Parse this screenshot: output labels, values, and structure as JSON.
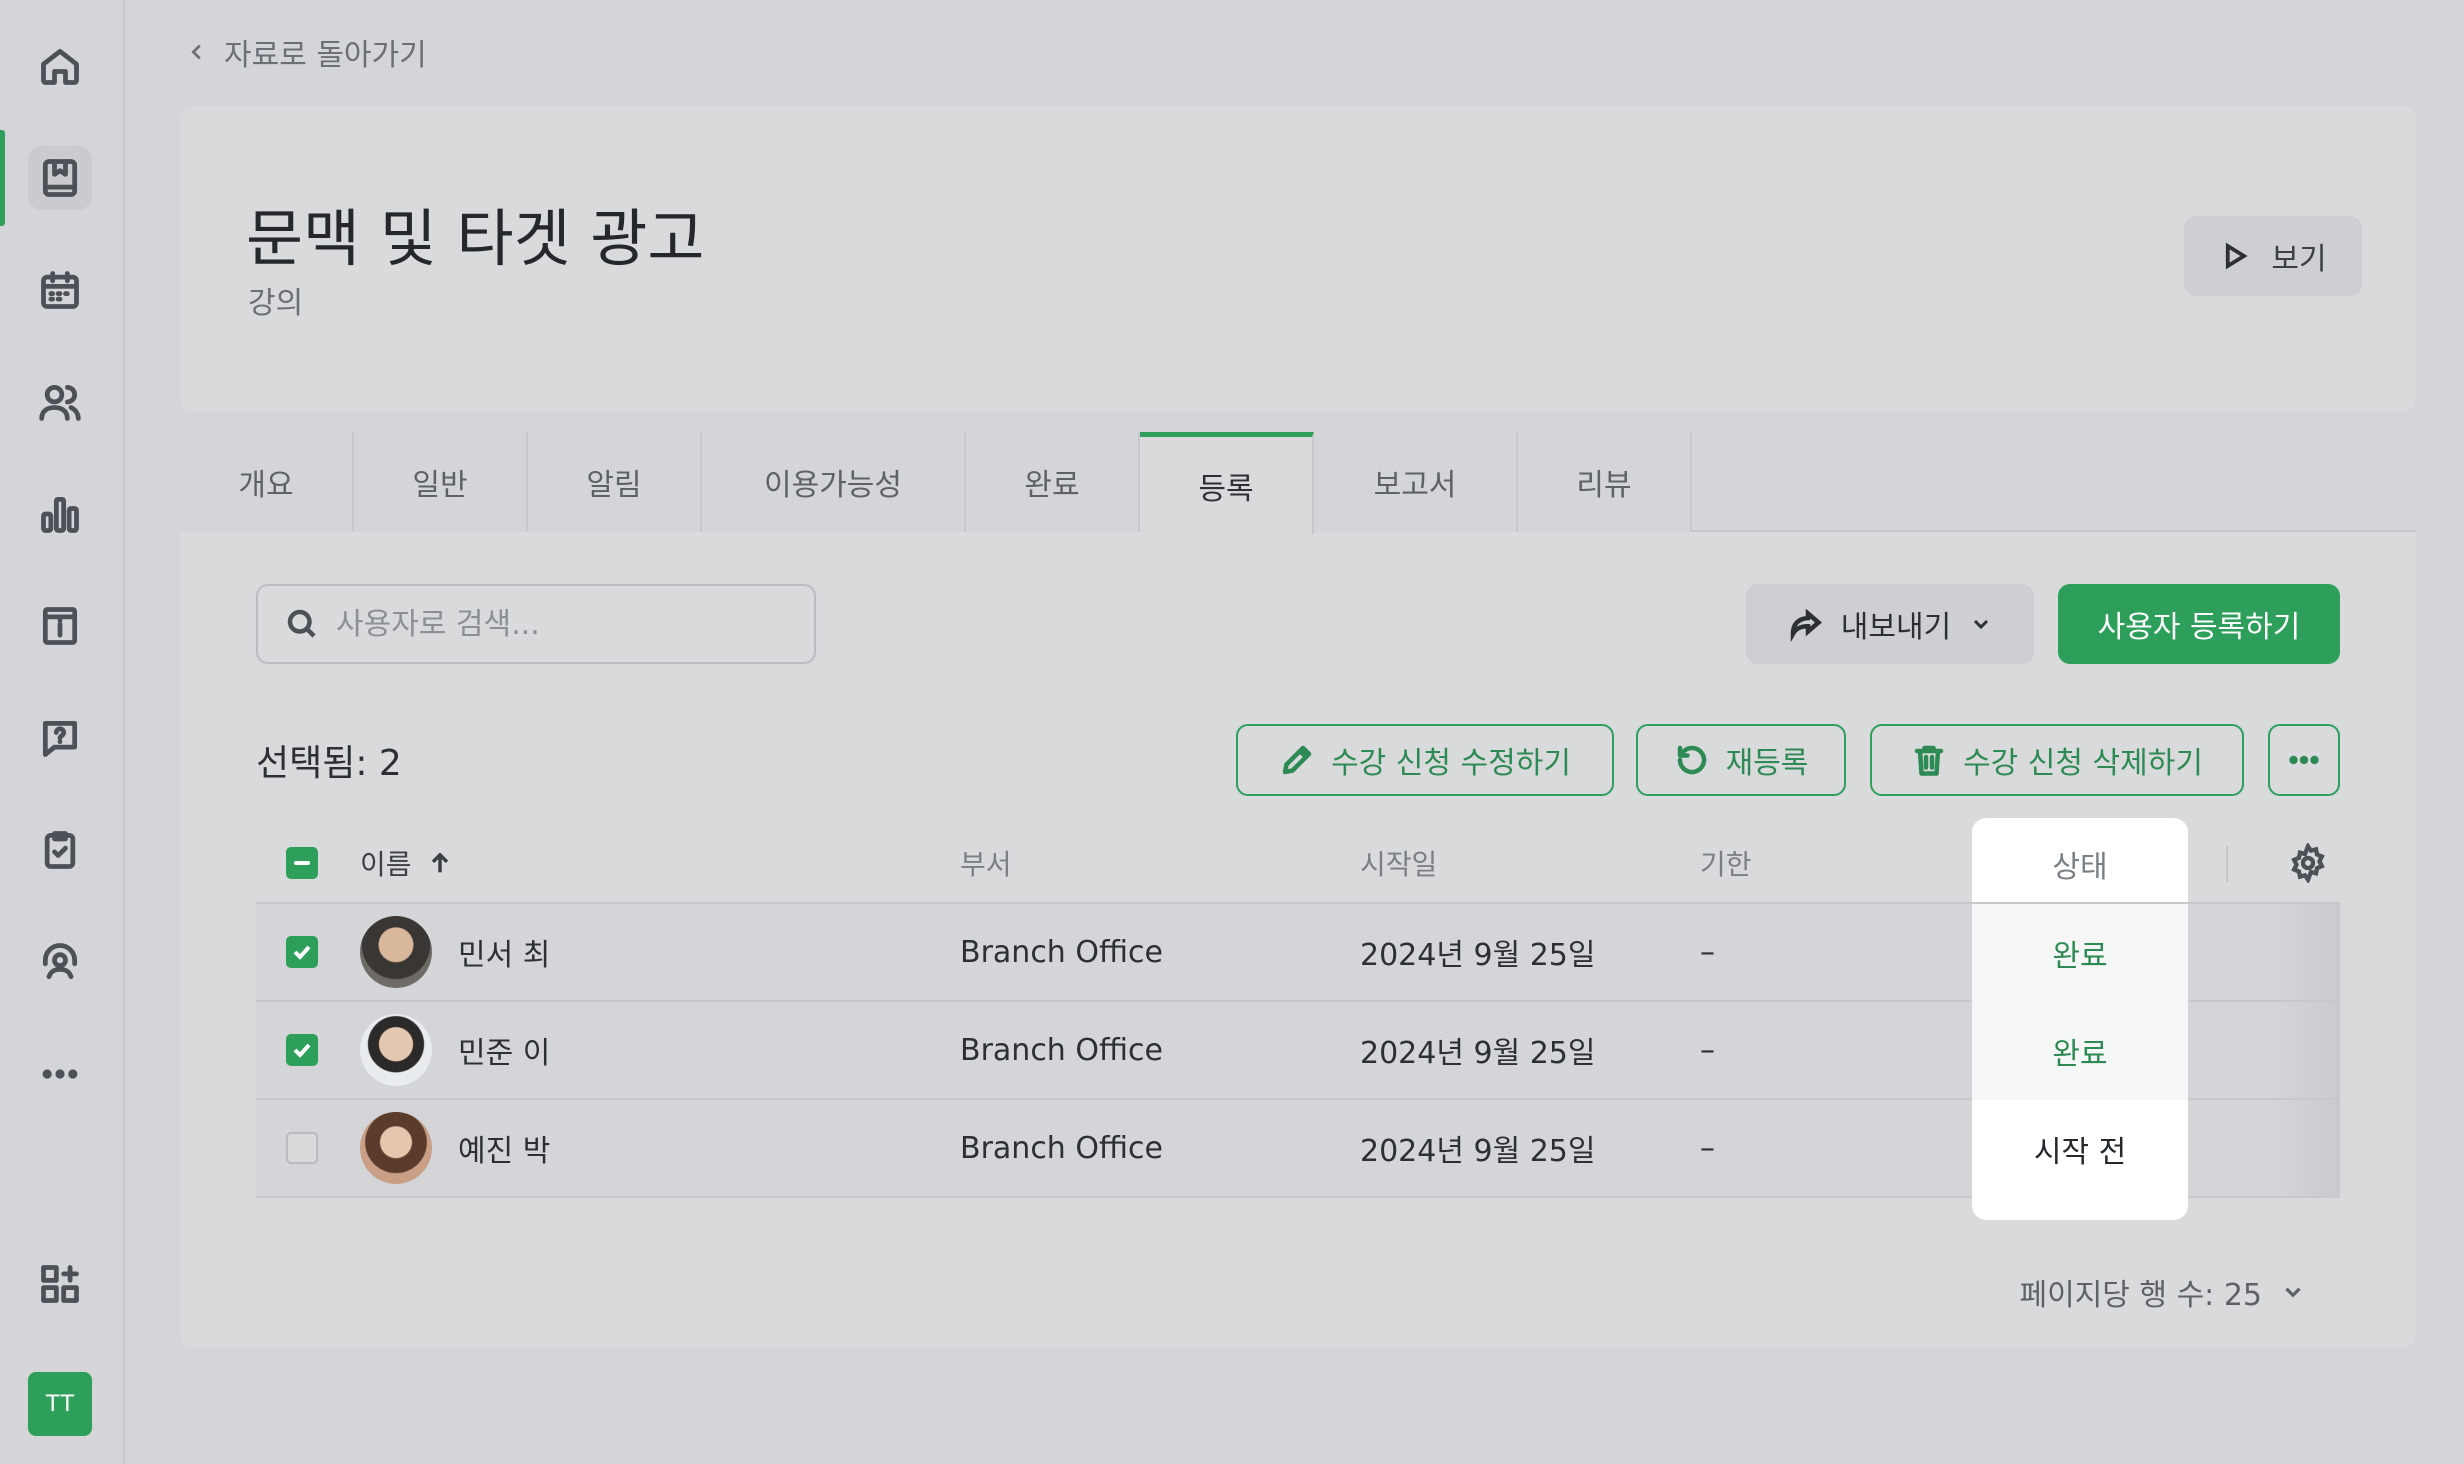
{
  "nav": {
    "back_label": "자료로 돌아가기",
    "items": [
      "home-icon",
      "courses-icon",
      "calendar-icon",
      "users-icon",
      "reports-icon",
      "catalog-icon",
      "help-icon",
      "tasks-icon",
      "support-icon",
      "more-icon",
      "add-widget-icon"
    ],
    "user_initials": "TT"
  },
  "header": {
    "title": "문맥 및 타겟 광고",
    "subtitle": "강의",
    "view_label": "보기"
  },
  "tabs": [
    "개요",
    "일반",
    "알림",
    "이용가능성",
    "완료",
    "등록",
    "보고서",
    "리뷰"
  ],
  "active_tab": "등록",
  "toolbar": {
    "search_placeholder": "사용자로 검색...",
    "export_label": "내보내기",
    "register_label": "사용자 등록하기"
  },
  "selection": {
    "selected_text": "선택됨: 2",
    "edit_label": "수강 신청 수정하기",
    "reenroll_label": "재등록",
    "delete_label": "수강 신청 삭제하기"
  },
  "table": {
    "columns": [
      "이름",
      "부서",
      "시작일",
      "기한",
      "상태"
    ],
    "rows": [
      {
        "name": "민서 최",
        "dept": "Branch Office",
        "start": "2024년 9월 25일",
        "due": "–",
        "status": "완료",
        "checked": true
      },
      {
        "name": "민준 이",
        "dept": "Branch Office",
        "start": "2024년 9월 25일",
        "due": "–",
        "status": "완료",
        "checked": true
      },
      {
        "name": "예진 박",
        "dept": "Branch Office",
        "start": "2024년 9월 25일",
        "due": "–",
        "status": "시작 전",
        "checked": false
      }
    ]
  },
  "pagination": {
    "rows_per_page": "페이지당 행 수: 25"
  },
  "colors": {
    "accent": "#2e9e5b",
    "status_done": "#2e8a54"
  }
}
